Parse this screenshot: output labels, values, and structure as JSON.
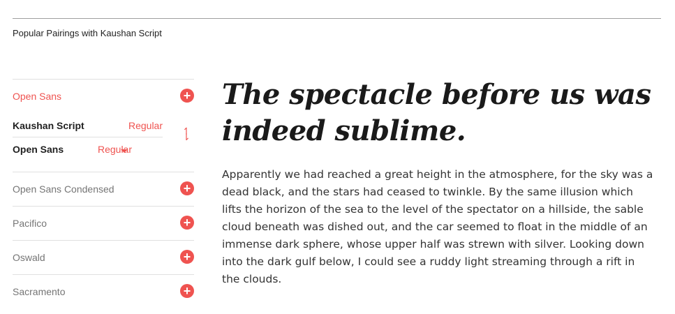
{
  "section_title": "Popular Pairings with Kaushan Script",
  "sidebar": {
    "items": [
      {
        "label": "Open Sans",
        "active": true
      },
      {
        "label": "Open Sans Condensed"
      },
      {
        "label": "Pacifico"
      },
      {
        "label": "Oswald"
      },
      {
        "label": "Sacramento"
      }
    ],
    "pairing": {
      "heading_font": "Kaushan Script",
      "heading_weight": "Regular",
      "body_font": "Open Sans",
      "body_weight": "Regular"
    }
  },
  "preview": {
    "headline": "The spectacle before us was indeed sublime.",
    "body": "Apparently we had reached a great height in the atmosphere, for the sky was a dead black, and the stars had ceased to twinkle. By the same illusion which lifts the horizon of the sea to the level of the spectator on a hillside, the sable cloud beneath was dished out, and the car seemed to float in the middle of an immense dark sphere, whose upper half was strewn with silver. Looking down into the dark gulf below, I could see a ruddy light streaming through a rift in the clouds."
  },
  "colors": {
    "accent": "#ef5350"
  }
}
